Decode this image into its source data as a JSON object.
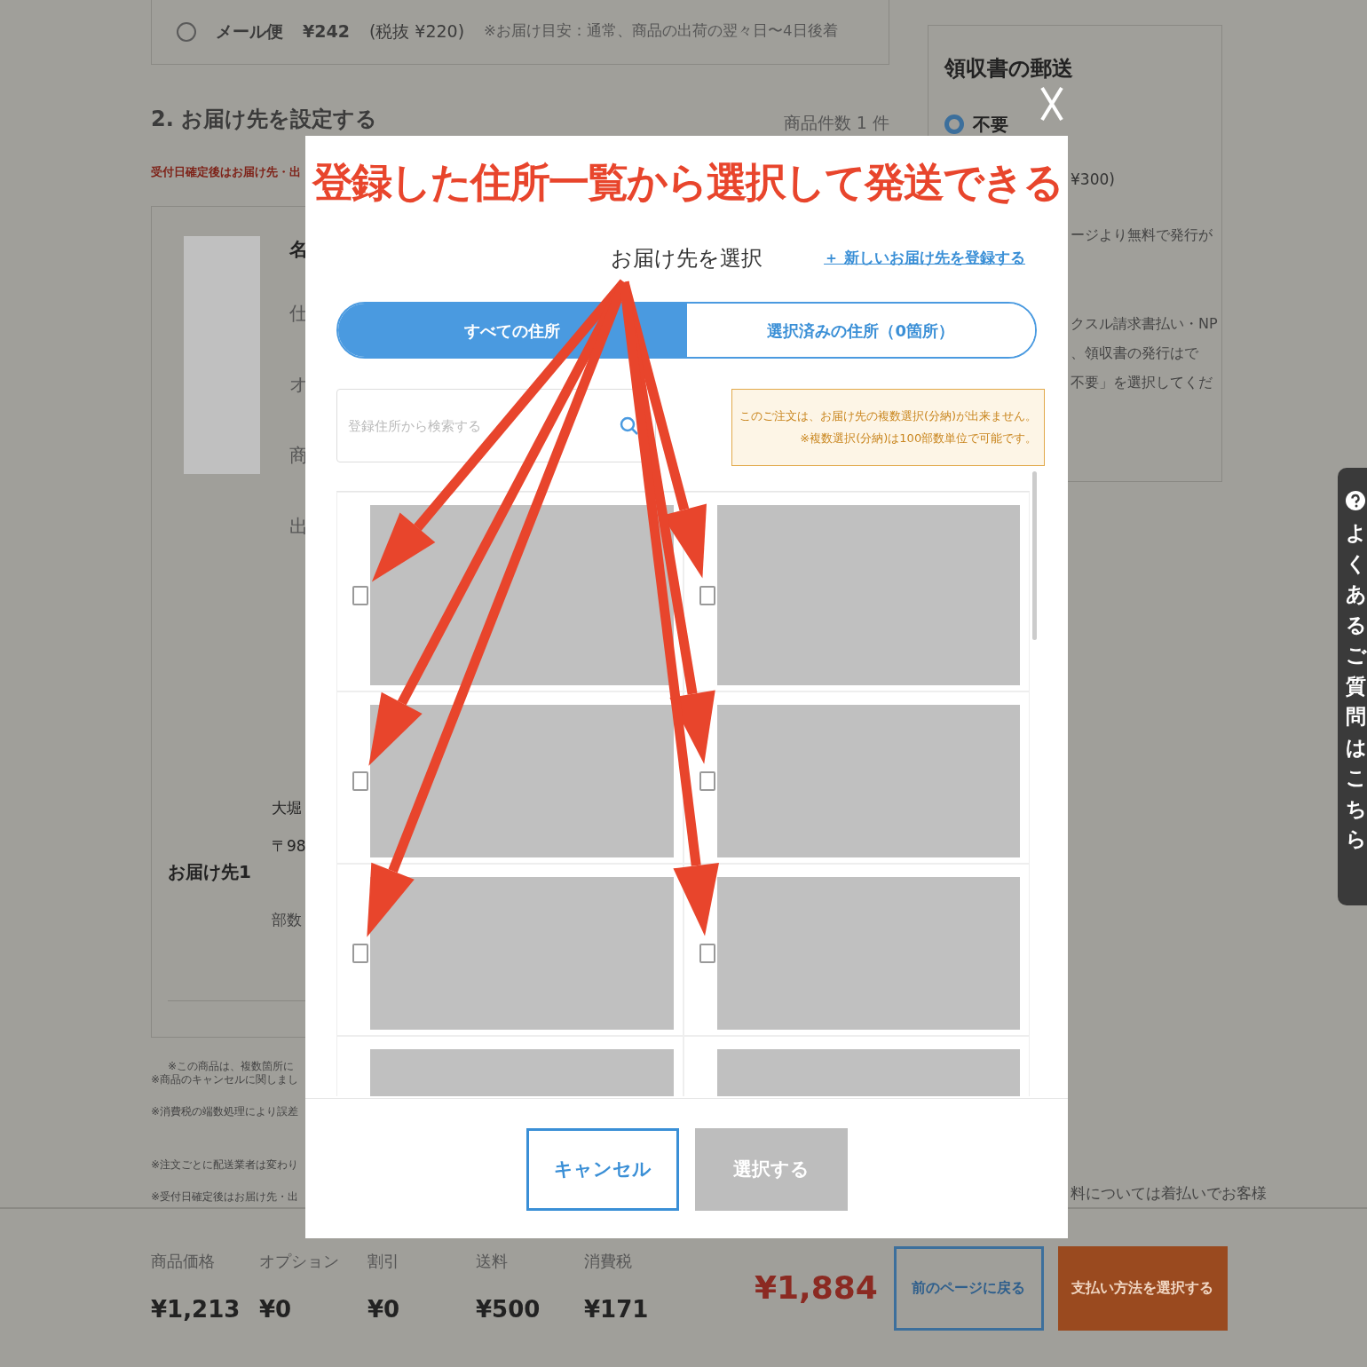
{
  "background": {
    "shipping_option": {
      "label": "メール便",
      "price": "¥242",
      "tax_note": "(税抜 ¥220)",
      "note": "※お届け目安：通常、商品の出荷の翌々日〜4日後着",
      "selected": false
    },
    "section_title": "2. お届け先を設定する",
    "item_count": "商品件数 1 件",
    "notice": "受付日確定後はお届け先・出",
    "product_lines": [
      "名",
      "仕",
      "オ",
      "商",
      "出"
    ],
    "destination": {
      "label": "お届け先1",
      "lines": [
        "大堀",
        "〒98",
        "部数"
      ]
    },
    "product_note": "※この商品は、複数箇所に",
    "notes": [
      "※商品のキャンセルに関しまし",
      "※消費税の端数処理により誤差",
      "※注文ごとに配送業者は変わり",
      "※受付日確定後はお届け先・出"
    ],
    "right_note": "料については着払いでお客様"
  },
  "receipt_panel": {
    "title": "領収書の郵送",
    "options": [
      {
        "label": "不要",
        "selected": true
      }
    ],
    "price_fragment": "¥300)",
    "lines": [
      "ージより無料で発行が",
      "クスル請求書払い・NP",
      "、領収書の発行はで",
      "不要」を選択してくだ"
    ]
  },
  "help_tab": {
    "label": "よくあるご質問はこちら"
  },
  "modal": {
    "title": "お届け先を選択",
    "add_link": "＋ 新しいお届け先を登録する",
    "tabs": [
      {
        "label": "すべての住所",
        "selected": true
      },
      {
        "label": "選択済みの住所（0箇所）",
        "selected": false
      }
    ],
    "search": {
      "placeholder": "登録住所から検索する"
    },
    "warning": [
      "このご注文は、お届け先の複数選択(分納)が出来ません。",
      "※複数選択(分納)は100部数単位で可能です。"
    ],
    "addresses": [
      {
        "kind": "full",
        "checked": false
      },
      {
        "kind": "full",
        "checked": false
      },
      {
        "kind": "full",
        "checked": false
      },
      {
        "kind": "full",
        "checked": false
      },
      {
        "kind": "full",
        "checked": false
      },
      {
        "kind": "full",
        "checked": false
      },
      {
        "kind": "cut"
      },
      {
        "kind": "cut"
      }
    ],
    "buttons": [
      {
        "label": "キャンセル",
        "kind": "secondary",
        "disabled": false
      },
      {
        "label": "選択する",
        "kind": "primary",
        "disabled": true
      }
    ]
  },
  "annotation": {
    "headline": "登録した住所一覧から選択して発送できる"
  },
  "summary": {
    "items": [
      {
        "label": "商品価格",
        "value": "¥1,213"
      },
      {
        "label": "オプション",
        "value": "¥0"
      },
      {
        "label": "割引",
        "value": "¥0"
      },
      {
        "label": "送料",
        "value": "¥500"
      },
      {
        "label": "消費税",
        "value": "¥171"
      }
    ],
    "total": "¥1,884",
    "back_button": "前のページに戻る",
    "next_button": "支払い方法を選択する"
  }
}
